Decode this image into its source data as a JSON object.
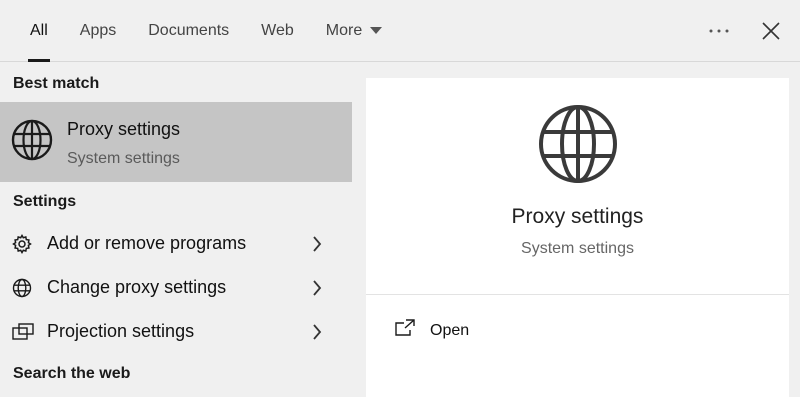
{
  "tabs": [
    {
      "label": "All",
      "active": true
    },
    {
      "label": "Apps"
    },
    {
      "label": "Documents"
    },
    {
      "label": "Web"
    },
    {
      "label": "More"
    }
  ],
  "sections": {
    "best_match": "Best match",
    "settings": "Settings",
    "search_web": "Search the web"
  },
  "best_match_item": {
    "title": "Proxy settings",
    "subtitle": "System settings",
    "icon": "globe-icon"
  },
  "settings_items": [
    {
      "label": "Add or remove programs",
      "icon": "gear-icon"
    },
    {
      "label": "Change proxy settings",
      "icon": "globe-icon"
    },
    {
      "label": "Projection settings",
      "icon": "projector-icon"
    }
  ],
  "preview": {
    "title": "Proxy settings",
    "subtitle": "System settings",
    "action_open": "Open"
  },
  "colors": {
    "selected_bg": "#c5c5c5",
    "pane_bg": "#f0f0f0",
    "preview_bg": "#ffffff"
  }
}
